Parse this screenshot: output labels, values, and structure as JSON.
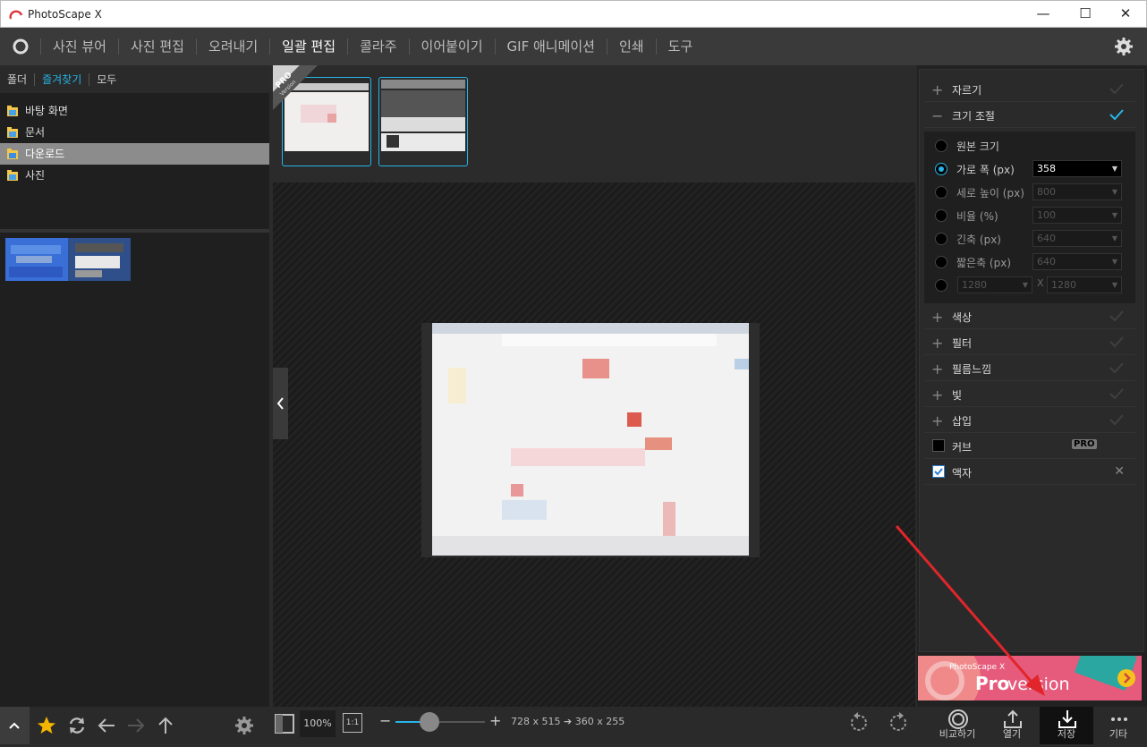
{
  "window": {
    "title": "PhotoScape X",
    "minimize": "—",
    "maximize": "☐",
    "close": "✕"
  },
  "nav": {
    "tabs": [
      "사진 뷰어",
      "사진 편집",
      "오려내기",
      "일괄 편집",
      "콜라주",
      "이어붙이기",
      "GIF 애니메이션",
      "인쇄",
      "도구"
    ],
    "active_index": 3
  },
  "folders": {
    "tabs": [
      "폴더",
      "즐겨찾기",
      "모두"
    ],
    "active_index": 1,
    "items": [
      {
        "label": "바탕 화면",
        "selected": false
      },
      {
        "label": "문서",
        "selected": false
      },
      {
        "label": "다운로드",
        "selected": true
      },
      {
        "label": "사진",
        "selected": false
      }
    ]
  },
  "filmstrip": {
    "pro_ribbon_top": "PRO",
    "pro_ribbon_bottom": "Version"
  },
  "panel": {
    "sections": [
      {
        "sign": "+",
        "label": "자르기",
        "checked": false
      },
      {
        "sign": "−",
        "label": "크기 조절",
        "checked": true
      }
    ],
    "resize": {
      "options": [
        {
          "label": "원본 크기",
          "selected": false,
          "enabled": true
        },
        {
          "label": "가로 폭 (px)",
          "selected": true,
          "enabled": true,
          "value": "358"
        },
        {
          "label": "세로 높이 (px)",
          "selected": false,
          "enabled": false,
          "value": "800"
        },
        {
          "label": "비율 (%)",
          "selected": false,
          "enabled": false,
          "value": "100"
        },
        {
          "label": "긴축 (px)",
          "selected": false,
          "enabled": false,
          "value": "640"
        },
        {
          "label": "짧은축 (px)",
          "selected": false,
          "enabled": false,
          "value": "640"
        }
      ],
      "custom": {
        "w": "1280",
        "sep": "X",
        "h": "1280"
      }
    },
    "more_sections": [
      {
        "sign": "+",
        "label": "색상"
      },
      {
        "sign": "+",
        "label": "필터"
      },
      {
        "sign": "+",
        "label": "필름느낌"
      },
      {
        "sign": "+",
        "label": "빛"
      },
      {
        "sign": "+",
        "label": "삽입"
      }
    ],
    "curves": {
      "label": "커브",
      "badge": "PRO"
    },
    "frame": {
      "label": "액자",
      "remove": "✕"
    }
  },
  "ad": {
    "small": "PhotoScape X",
    "big_a": "Pro",
    "big_b": " version"
  },
  "bottom": {
    "zoom": "100%",
    "one_to_one": "1:1",
    "minus": "−",
    "plus": "+",
    "zoom_level": 0.38,
    "size_info": "728 x 515 ➔ 360 x 255",
    "actions": [
      "비교하기",
      "열기",
      "저장",
      "기타"
    ]
  },
  "colors": {
    "accent": "#27b4e8",
    "arrow": "#e0262b"
  }
}
